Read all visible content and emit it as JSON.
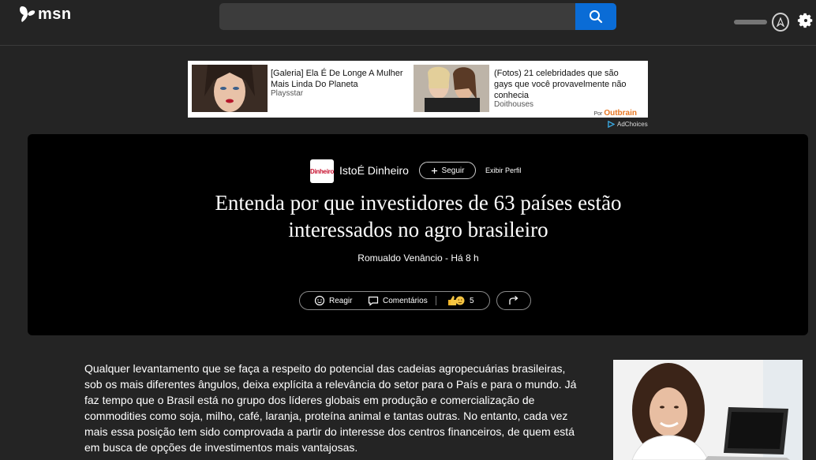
{
  "header": {
    "logo_text": "msn",
    "search_placeholder": "",
    "user_name_blurred": "",
    "rewards_icon": "medal-icon",
    "settings_icon": "gear-icon"
  },
  "ad": {
    "items": [
      {
        "title": "[Galeria] Ela É De Longe A Mulher Mais Linda Do Planeta",
        "source": "Playsstar"
      },
      {
        "title": "(Fotos) 21 celebridades que são gays que você provavelmente não conhecia",
        "source": "Doithouses"
      }
    ],
    "powered_by": "Por",
    "powered_brand": "Outbrain",
    "adchoices": "AdChoices"
  },
  "article": {
    "publisher_logo": "Dinheiro",
    "publisher": "IstoÉ Dinheiro",
    "follow_label": "Seguir",
    "profile_label": "Exibir Perfil",
    "title": "Entenda por que investidores de 63 países estão interessados no agro brasileiro",
    "byline": "Romualdo Venâncio - Há 8 h",
    "react_label": "Reagir",
    "comments_label": "Comentários",
    "reactions_count": "5",
    "body": "Qualquer levantamento que se faça a respeito do potencial das cadeias agropecuárias brasileiras, sob os mais diferentes ângulos, deixa explícita a relevância do setor para o País e para o mundo. Já faz tempo que o Brasil está no grupo dos líderes globais em produção e comercialização de commodities como soja, milho, café, laranja, proteína animal e tantas outras. No entanto, cada vez mais essa posição tem sido comprovada a partir do interesse dos centros financeiros, de quem está em busca de opções de investimentos mais vantajosas."
  },
  "colors": {
    "background": "#242424",
    "accent": "#0a6cd6",
    "hero_bg": "#000000"
  }
}
